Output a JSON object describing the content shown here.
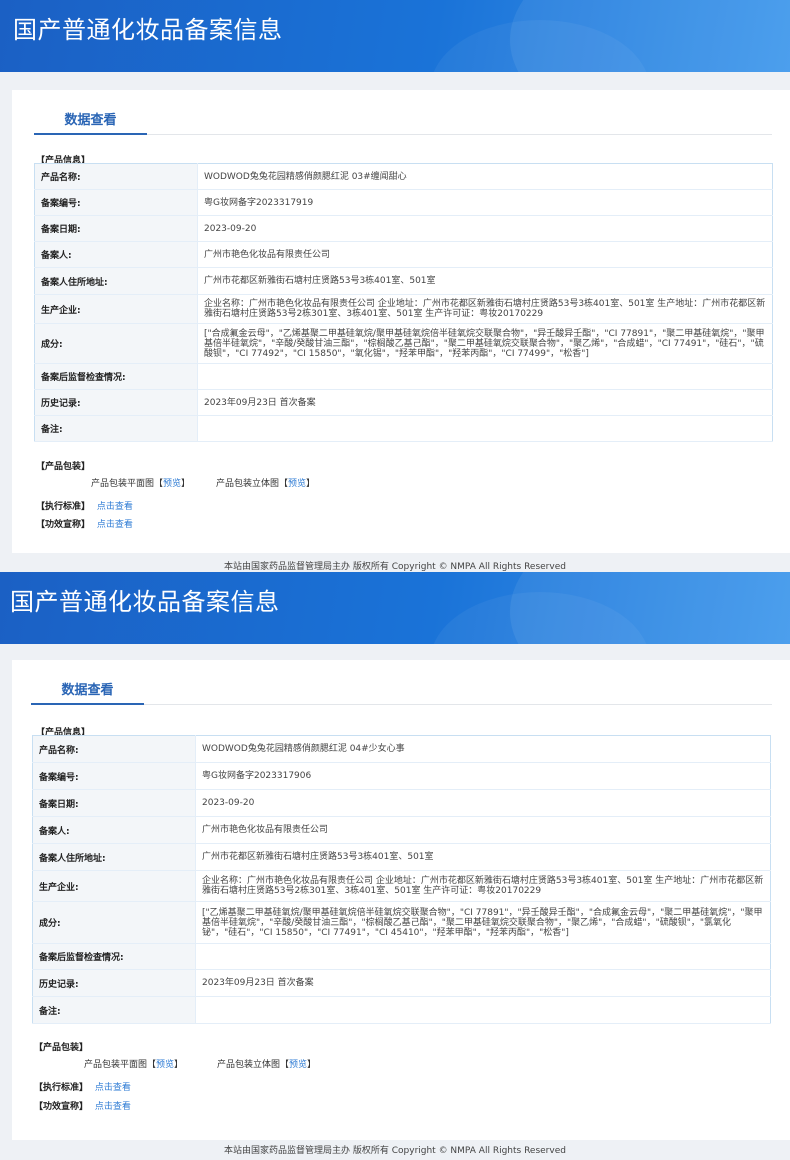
{
  "records": [
    {
      "banner_title": "国产普通化妆品备案信息",
      "tab_label": "数据查看",
      "product_info_label": "【产品信息】",
      "rows": [
        {
          "key": "产品名称:",
          "value": "WODWOD兔兔花园精感俏颜腮红泥 03#缠闻甜心"
        },
        {
          "key": "备案编号:",
          "value": "粤G妆网备字2023317919"
        },
        {
          "key": "备案日期:",
          "value": "2023-09-20"
        },
        {
          "key": "备案人:",
          "value": "广州市艳色化妆品有限责任公司"
        },
        {
          "key": "备案人住所地址:",
          "value": "广州市花都区新雅街石塘村庄贤路53号3栋401室、501室"
        },
        {
          "key": "生产企业:",
          "value": "企业名称：广州市艳色化妆品有限责任公司 企业地址：广州市花都区新雅街石塘村庄贤路53号3栋401室、501室 生产地址：广州市花都区新雅街石塘村庄贤路53号2栋301室、3栋401室、501室 生产许可证：粤妆20170229"
        },
        {
          "key": "成分:",
          "value": "[\"合成氟金云母\"，\"乙烯基聚二甲基硅氧烷/聚甲基硅氧烷倍半硅氧烷交联聚合物\"，\"异壬酸异壬酯\"，\"CI 77891\"，\"聚二甲基硅氧烷\"，\"聚甲基倍半硅氧烷\"，\"辛酸/癸酸甘油三酯\"，\"棕榈酸乙基己酯\"，\"聚二甲基硅氧烷交联聚合物\"，\"聚乙烯\"，\"合成蜡\"，\"CI 77491\"，\"硅石\"，\"硫酸钡\"，\"CI 77492\"，\"CI 15850\"，\"氧化锡\"，\"羟苯甲酯\"，\"羟苯丙酯\"，\"CI 77499\"，\"松香\"]"
        },
        {
          "key": "备案后监督检查情况:",
          "value": ""
        },
        {
          "key": "历史记录:",
          "value": "2023年09月23日 首次备案"
        },
        {
          "key": "备注:",
          "value": ""
        }
      ],
      "package_label": "【产品包装】",
      "package_flat_label": "产品包装平面图",
      "package_3d_label": "产品包装立体图",
      "preview_link": "预览",
      "bracket_open": "【",
      "bracket_close": "】",
      "standard_label": "【执行标准】",
      "efficacy_label": "【功效宣称】",
      "view_link": "点击查看",
      "footer": "本站由国家药品监督管理局主办 版权所有 Copyright © NMPA All Rights Reserved"
    },
    {
      "banner_title": "国产普通化妆品备案信息",
      "tab_label": "数据查看",
      "product_info_label": "【产品信息】",
      "rows": [
        {
          "key": "产品名称:",
          "value": "WODWOD兔兔花园精感俏颜腮红泥 04#少女心事"
        },
        {
          "key": "备案编号:",
          "value": "粤G妆网备字2023317906"
        },
        {
          "key": "备案日期:",
          "value": "2023-09-20"
        },
        {
          "key": "备案人:",
          "value": "广州市艳色化妆品有限责任公司"
        },
        {
          "key": "备案人住所地址:",
          "value": "广州市花都区新雅街石塘村庄贤路53号3栋401室、501室"
        },
        {
          "key": "生产企业:",
          "value": "企业名称：广州市艳色化妆品有限责任公司 企业地址：广州市花都区新雅街石塘村庄贤路53号3栋401室、501室 生产地址：广州市花都区新雅街石塘村庄贤路53号2栋301室、3栋401室、501室 生产许可证：粤妆20170229"
        },
        {
          "key": "成分:",
          "value": "[\"乙烯基聚二甲基硅氧烷/聚甲基硅氧烷倍半硅氧烷交联聚合物\"，\"CI 77891\"，\"异壬酸异壬酯\"，\"合成氟金云母\"，\"聚二甲基硅氧烷\"，\"聚甲基倍半硅氧烷\"，\"辛酸/癸酸甘油三酯\"，\"棕榈酸乙基己酯\"，\"聚二甲基硅氧烷交联聚合物\"，\"聚乙烯\"，\"合成蜡\"，\"硫酸钡\"，\"氯氧化铋\"，\"硅石\"，\"CI 15850\"，\"CI 77491\"，\"CI 45410\"，\"羟苯甲酯\"，\"羟苯丙酯\"，\"松香\"]"
        },
        {
          "key": "备案后监督检查情况:",
          "value": ""
        },
        {
          "key": "历史记录:",
          "value": "2023年09月23日 首次备案"
        },
        {
          "key": "备注:",
          "value": ""
        }
      ],
      "package_label": "【产品包装】",
      "package_flat_label": "产品包装平面图",
      "package_3d_label": "产品包装立体图",
      "preview_link": "预览",
      "bracket_open": "【",
      "bracket_close": "】",
      "standard_label": "【执行标准】",
      "efficacy_label": "【功效宣称】",
      "view_link": "点击查看",
      "footer": "本站由国家药品监督管理局主办 版权所有 Copyright © NMPA All Rights Reserved"
    }
  ]
}
